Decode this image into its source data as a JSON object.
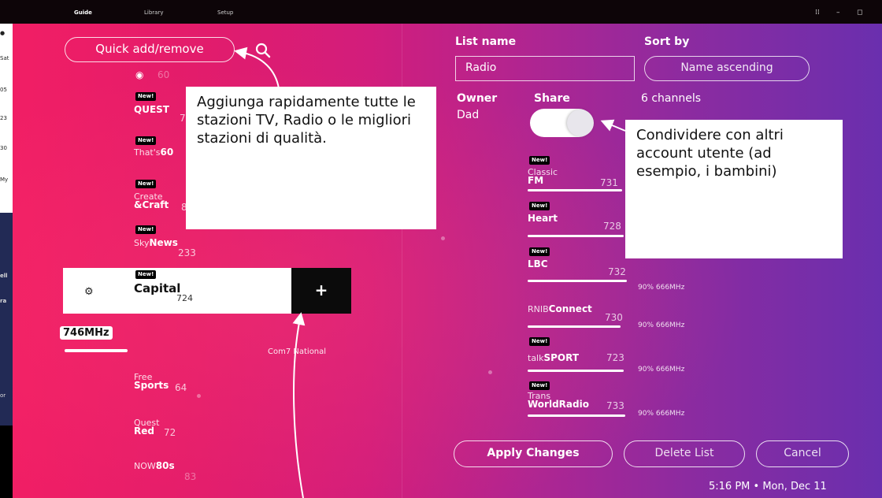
{
  "tabs": {
    "guide": "Guide",
    "library": "Library",
    "setup": "Setup"
  },
  "window": {
    "controls": [
      "⁞⁞",
      "–",
      "◻"
    ]
  },
  "left_strip": {
    "labels": [
      "Sat",
      "05",
      "23",
      "30",
      "My",
      "ell",
      "ra",
      "or"
    ]
  },
  "left_panel": {
    "quick_add_label": "Quick add/remove",
    "channels": [
      {
        "badge": "",
        "name_thin": "",
        "name_bold": "",
        "number": "60"
      },
      {
        "badge": "New!",
        "name_thin": "",
        "name_bold": "QUEST",
        "number": "71"
      },
      {
        "badge": "New!",
        "name_thin": "That's",
        "name_bold": "60",
        "number": ""
      },
      {
        "badge": "New!",
        "name_thin": "Create",
        "name_bold": "&Craft",
        "number": "8"
      },
      {
        "badge": "New!",
        "name_thin": "Sky",
        "name_bold": "News",
        "number": "233"
      }
    ],
    "selected": {
      "badge": "New!",
      "name": "Capital",
      "number": "724",
      "add_label": "+"
    },
    "frequency": "746MHz",
    "mux_name": "Com7 National",
    "more_channels": [
      {
        "name_thin": "Free",
        "name_bold": "Sports",
        "number": "64"
      },
      {
        "name_thin": "Quest",
        "name_bold": "Red",
        "number": "72"
      },
      {
        "name_thin": "NOW",
        "name_bold": "80s",
        "number": "83"
      }
    ]
  },
  "right_panel": {
    "list_name_label": "List name",
    "list_name_value": "Radio",
    "sort_by_label": "Sort by",
    "sort_by_value": "Name ascending",
    "owner_label": "Owner",
    "owner_value": "Dad",
    "share_label": "Share",
    "share_on": true,
    "channel_count": "6 channels",
    "channels": [
      {
        "badge": "New!",
        "name_thin": "Classic",
        "name_bold": "FM",
        "number": "731",
        "signal": ""
      },
      {
        "badge": "New!",
        "name_thin": "",
        "name_bold": "Heart",
        "number": "728",
        "signal": ""
      },
      {
        "badge": "New!",
        "name_thin": "",
        "name_bold": "LBC",
        "number": "732",
        "signal": "90% 666MHz"
      },
      {
        "badge": "",
        "name_thin": "RNIB",
        "name_bold": "Connect",
        "number": "730",
        "signal": "90% 666MHz"
      },
      {
        "badge": "New!",
        "name_thin": "talk",
        "name_bold": "SPORT",
        "number": "723",
        "signal": "90% 666MHz"
      },
      {
        "badge": "New!",
        "name_thin": "Trans",
        "name_bold": "WorldRadio",
        "number": "733",
        "signal": "90% 666MHz"
      }
    ],
    "buttons": {
      "apply": "Apply Changes",
      "delete": "Delete List",
      "cancel": "Cancel"
    },
    "clock": "5:16 PM • Mon, Dec 11"
  },
  "callouts": {
    "left": "Aggiunga rapidamente tutte le stazioni TV, Radio o le migliori stazioni di qualità.",
    "right": "Condividere con altri account utente (ad esempio, i bambini)"
  }
}
